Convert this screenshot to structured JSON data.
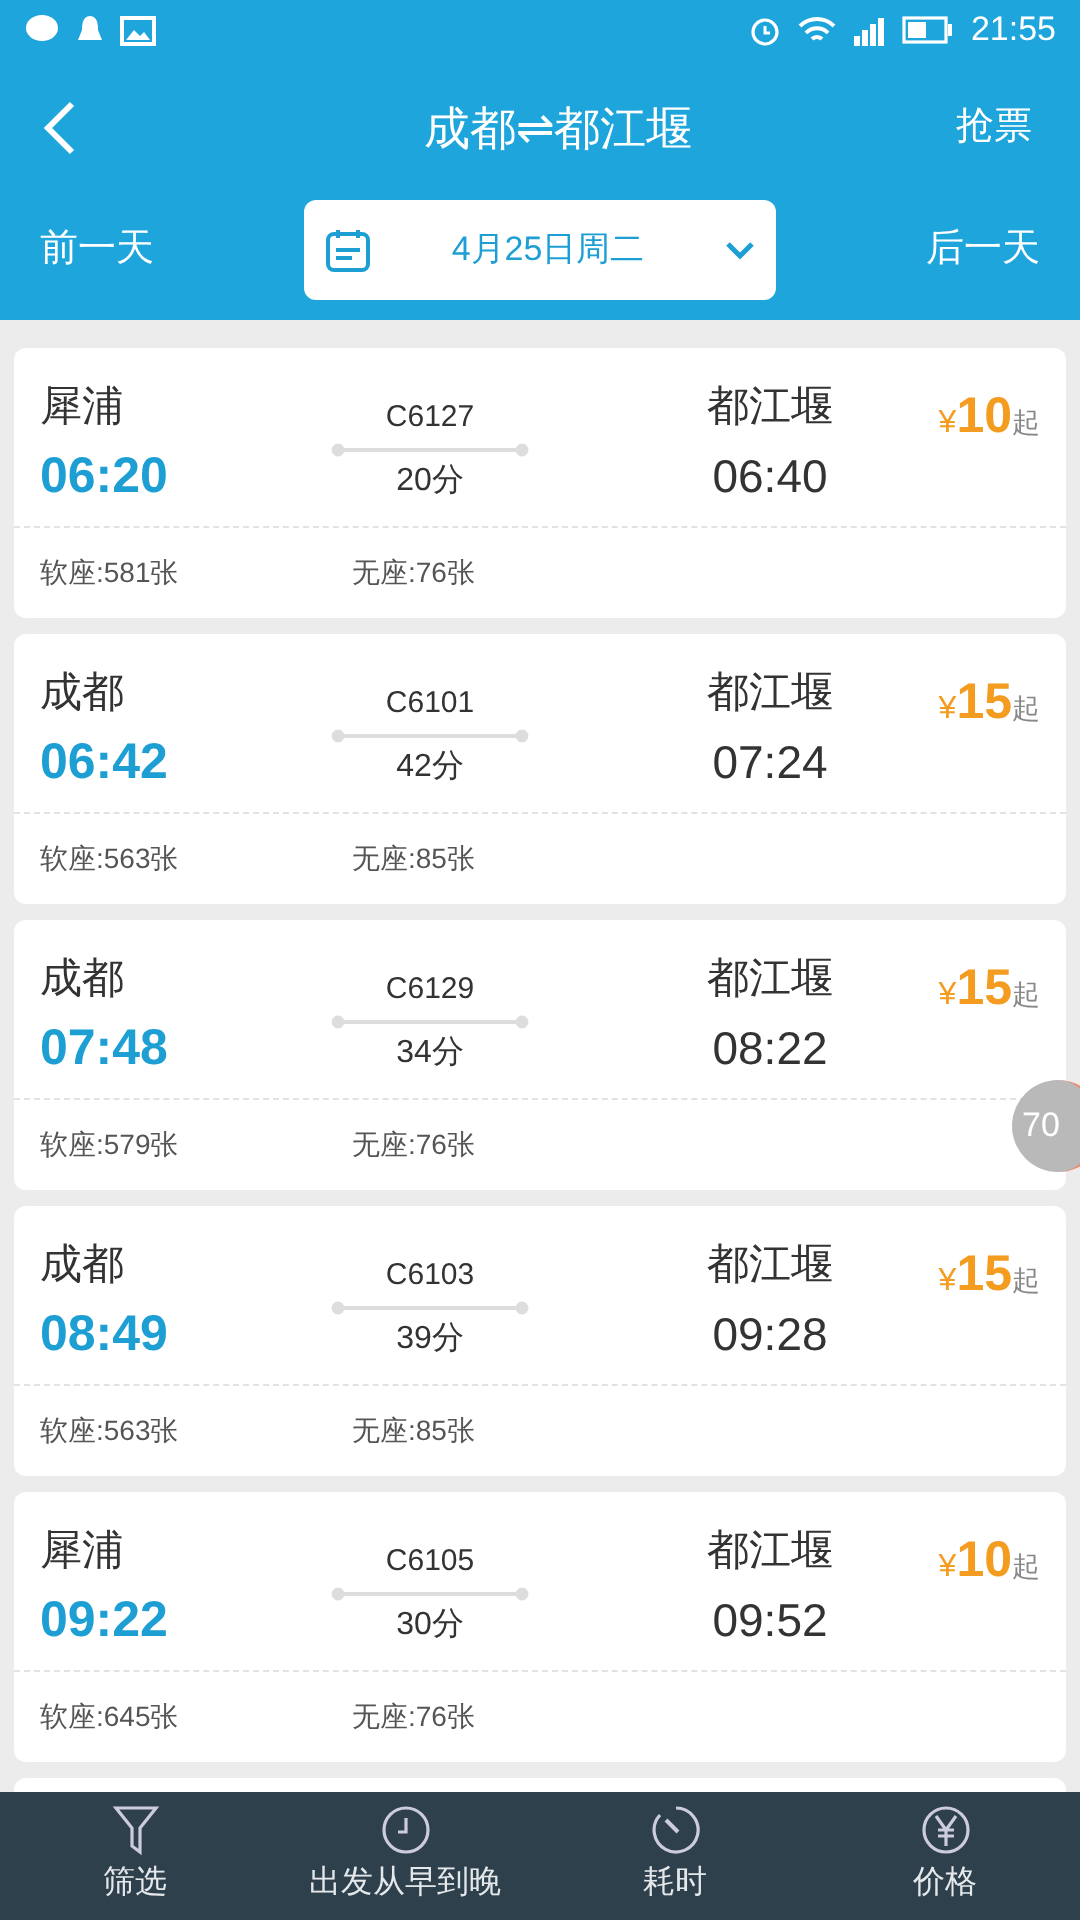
{
  "status_bar": {
    "time": "21:55"
  },
  "header": {
    "title": "成都⇌都江堰",
    "action": "抢票"
  },
  "date_bar": {
    "prev": "前一天",
    "date": "4月25日周二",
    "next": "后一天"
  },
  "trains": [
    {
      "from": "犀浦",
      "depart": "06:20",
      "number": "C6127",
      "duration": "20分",
      "to": "都江堰",
      "arrive": "06:40",
      "currency": "¥",
      "price": "10",
      "price_suffix": "起",
      "seats": [
        "软座:581张",
        "无座:76张"
      ]
    },
    {
      "from": "成都",
      "depart": "06:42",
      "number": "C6101",
      "duration": "42分",
      "to": "都江堰",
      "arrive": "07:24",
      "currency": "¥",
      "price": "15",
      "price_suffix": "起",
      "seats": [
        "软座:563张",
        "无座:85张"
      ]
    },
    {
      "from": "成都",
      "depart": "07:48",
      "number": "C6129",
      "duration": "34分",
      "to": "都江堰",
      "arrive": "08:22",
      "currency": "¥",
      "price": "15",
      "price_suffix": "起",
      "seats": [
        "软座:579张",
        "无座:76张"
      ]
    },
    {
      "from": "成都",
      "depart": "08:49",
      "number": "C6103",
      "duration": "39分",
      "to": "都江堰",
      "arrive": "09:28",
      "currency": "¥",
      "price": "15",
      "price_suffix": "起",
      "seats": [
        "软座:563张",
        "无座:85张"
      ]
    },
    {
      "from": "犀浦",
      "depart": "09:22",
      "number": "C6105",
      "duration": "30分",
      "to": "都江堰",
      "arrive": "09:52",
      "currency": "¥",
      "price": "10",
      "price_suffix": "起",
      "seats": [
        "软座:645张",
        "无座:76张"
      ]
    }
  ],
  "side_badge": "70",
  "bottom_bar": [
    {
      "kind": "filter",
      "label": "筛选"
    },
    {
      "kind": "clock",
      "label": "出发从早到晚"
    },
    {
      "kind": "timer",
      "label": "耗时"
    },
    {
      "kind": "yen",
      "label": "价格"
    }
  ]
}
